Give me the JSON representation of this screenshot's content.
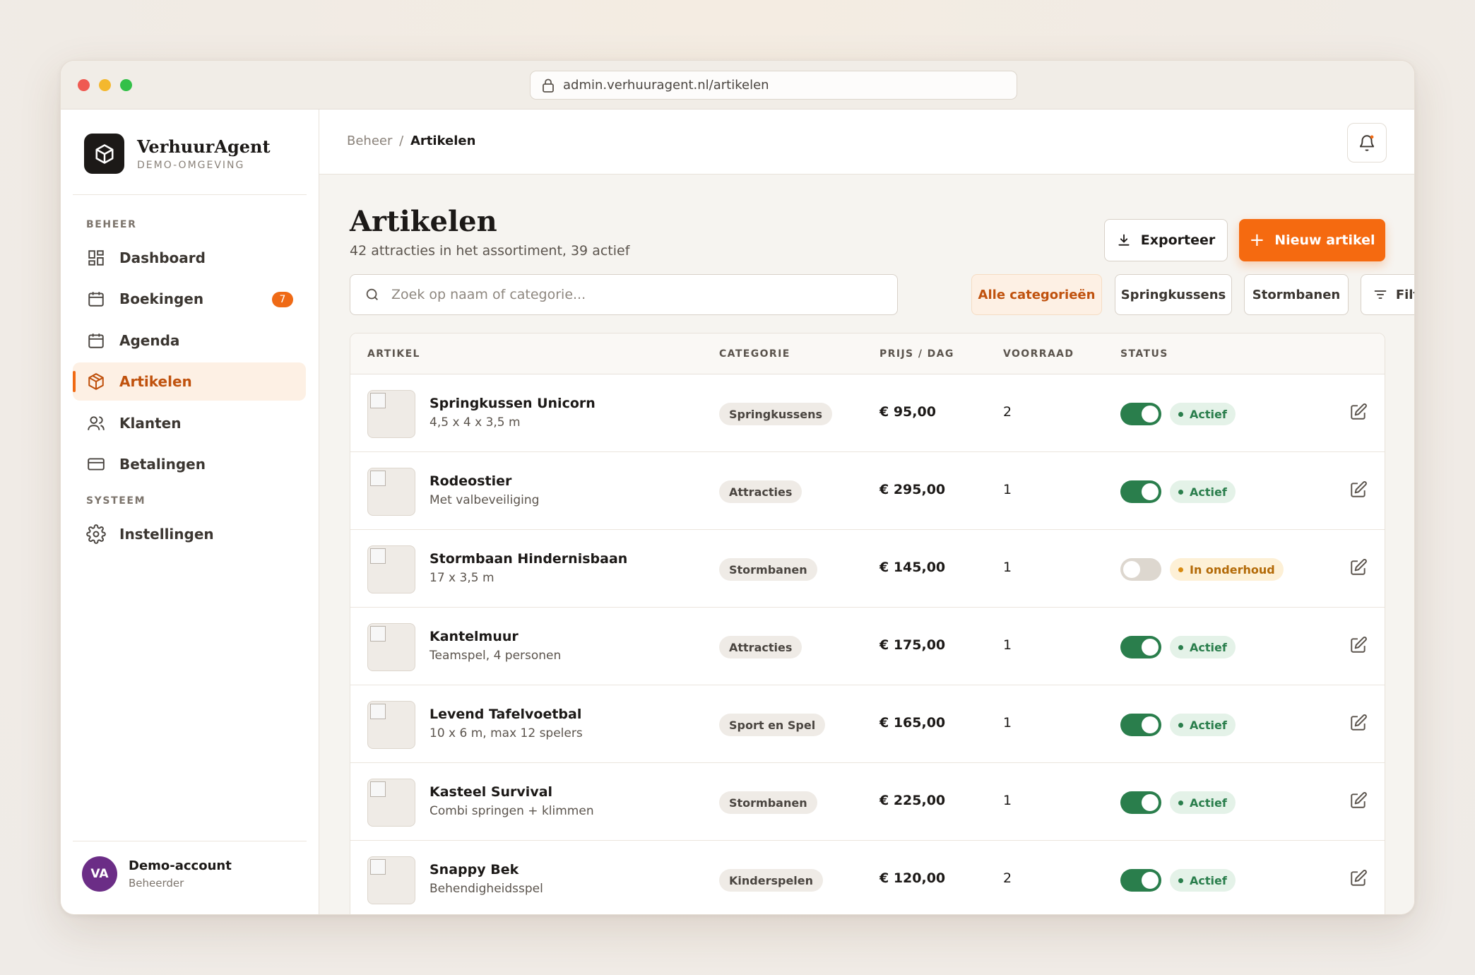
{
  "browser": {
    "url": "admin.verhuuragent.nl/artikelen"
  },
  "brand": {
    "name": "VerhuurAgent",
    "subtitle": "DEMO-OMGEVING"
  },
  "nav": {
    "section_manage": "BEHEER",
    "section_system": "SYSTEEM",
    "items": [
      {
        "label": "Dashboard",
        "icon": "dashboard-icon"
      },
      {
        "label": "Boekingen",
        "icon": "calendar-icon",
        "badge": "7"
      },
      {
        "label": "Agenda",
        "icon": "calendar-icon"
      },
      {
        "label": "Artikelen",
        "icon": "package-icon",
        "active": true
      },
      {
        "label": "Klanten",
        "icon": "users-icon"
      },
      {
        "label": "Betalingen",
        "icon": "credit-card-icon"
      },
      {
        "label": "Instellingen",
        "icon": "gear-icon"
      }
    ]
  },
  "user": {
    "initials": "VA",
    "name": "Demo-account",
    "role": "Beheerder"
  },
  "breadcrumb": {
    "parent": "Beheer",
    "separator": "/",
    "current": "Artikelen"
  },
  "page": {
    "title": "Artikelen",
    "subtitle": "42 attracties in het assortiment, 39 actief",
    "export_label": "Exporteer",
    "new_label": "Nieuw artikel"
  },
  "search": {
    "placeholder": "Zoek op naam of categorie..."
  },
  "filters": {
    "chips": [
      "Alle categorieën",
      "Springkussens",
      "Stormbanen"
    ],
    "filter_label": "Filter"
  },
  "table": {
    "headers": {
      "article": "ARTIKEL",
      "category": "CATEGORIE",
      "price": "PRIJS / DAG",
      "stock": "VOORRAAD",
      "status": "STATUS"
    },
    "rows": [
      {
        "name": "Springkussen Unicorn",
        "desc": "4,5 x 4 x 3,5 m",
        "category": "Springkussens",
        "price": "€ 95,00",
        "stock": "2",
        "enabled": true,
        "status": "Actief"
      },
      {
        "name": "Rodeostier",
        "desc": "Met valbeveiliging",
        "category": "Attracties",
        "price": "€ 295,00",
        "stock": "1",
        "enabled": true,
        "status": "Actief"
      },
      {
        "name": "Stormbaan Hindernisbaan",
        "desc": "17 x 3,5 m",
        "category": "Stormbanen",
        "price": "€ 145,00",
        "stock": "1",
        "enabled": false,
        "status": "In onderhoud"
      },
      {
        "name": "Kantelmuur",
        "desc": "Teamspel, 4 personen",
        "category": "Attracties",
        "price": "€ 175,00",
        "stock": "1",
        "enabled": true,
        "status": "Actief"
      },
      {
        "name": "Levend Tafelvoetbal",
        "desc": "10 x 6 m, max 12 spelers",
        "category": "Sport en Spel",
        "price": "€ 165,00",
        "stock": "1",
        "enabled": true,
        "status": "Actief"
      },
      {
        "name": "Kasteel Survival",
        "desc": "Combi springen + klimmen",
        "category": "Stormbanen",
        "price": "€ 225,00",
        "stock": "1",
        "enabled": true,
        "status": "Actief"
      },
      {
        "name": "Snappy Bek",
        "desc": "Behendigheidsspel",
        "category": "Kinderspelen",
        "price": "€ 120,00",
        "stock": "2",
        "enabled": true,
        "status": "Actief"
      }
    ]
  },
  "colors": {
    "accent": "#f56a10",
    "success": "#2a7e4c",
    "warning": "#d88a10",
    "dark": "#1c1917"
  }
}
